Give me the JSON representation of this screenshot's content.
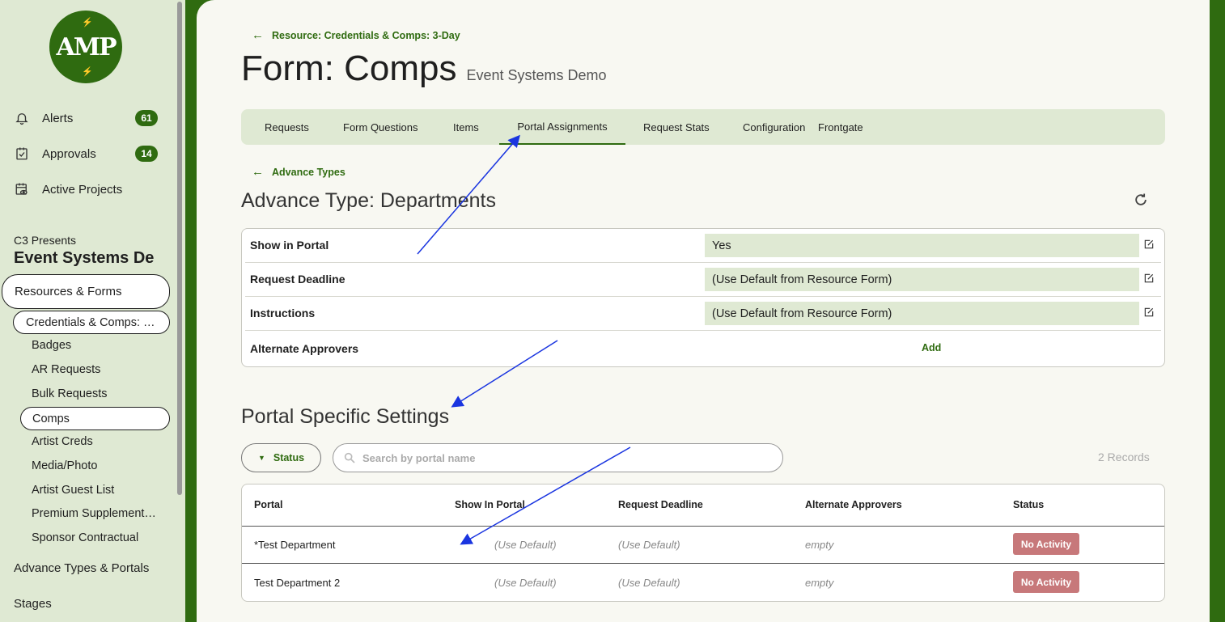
{
  "sidebar": {
    "logo_text": "AMP",
    "nav": [
      {
        "label": "Alerts",
        "icon": "bell-icon",
        "badge": "61"
      },
      {
        "label": "Approvals",
        "icon": "clipboard-check-icon",
        "badge": "14"
      },
      {
        "label": "Active Projects",
        "icon": "calendar-eye-icon"
      }
    ],
    "org": "C3 Presents",
    "project": "Event Systems De",
    "section_active": "Resources & Forms",
    "resource_active": "Credentials & Comps: …",
    "sub_items": [
      "Badges",
      "AR Requests",
      "Bulk Requests",
      "Comps",
      "Artist Creds",
      "Media/Photo",
      "Artist Guest List",
      "Premium Supplement…",
      "Sponsor Contractual"
    ],
    "sections": [
      "Advance Types & Portals",
      "Stages"
    ]
  },
  "main": {
    "back_link": "Resource: Credentials & Comps: 3-Day",
    "title": "Form: Comps",
    "subtitle": "Event Systems Demo",
    "tabs": [
      "Requests",
      "Form Questions",
      "Items",
      "Portal Assignments",
      "Request Stats",
      "Configuration",
      "Frontgate"
    ],
    "active_tab": "Portal Assignments",
    "advance_back_link": "Advance Types",
    "advance_title": "Advance Type: Departments",
    "settings": [
      {
        "label": "Show in Portal",
        "value": "Yes"
      },
      {
        "label": "Request Deadline",
        "value": "(Use Default from Resource Form)"
      },
      {
        "label": "Instructions",
        "value": "(Use Default from Resource Form)"
      },
      {
        "label": "Alternate Approvers",
        "action": "Add"
      }
    ],
    "portal_title": "Portal Specific Settings",
    "filter_label": "Status",
    "search_placeholder": "Search by portal name",
    "records": "2 Records",
    "table": {
      "headers": [
        "Portal",
        "Show In Portal",
        "Request Deadline",
        "Alternate Approvers",
        "Status"
      ],
      "rows": [
        {
          "portal": "*Test Department",
          "show": "(Use Default)",
          "deadline": "(Use Default)",
          "approvers": "empty",
          "status": "No Activity"
        },
        {
          "portal": "Test Department 2",
          "show": "(Use Default)",
          "deadline": "(Use Default)",
          "approvers": "empty",
          "status": "No Activity"
        }
      ]
    }
  },
  "colors": {
    "brand": "#2f6b10",
    "light_green": "#dfe9d3",
    "status_chip": "#c7787a",
    "annotation_arrow": "#1a35e0"
  }
}
